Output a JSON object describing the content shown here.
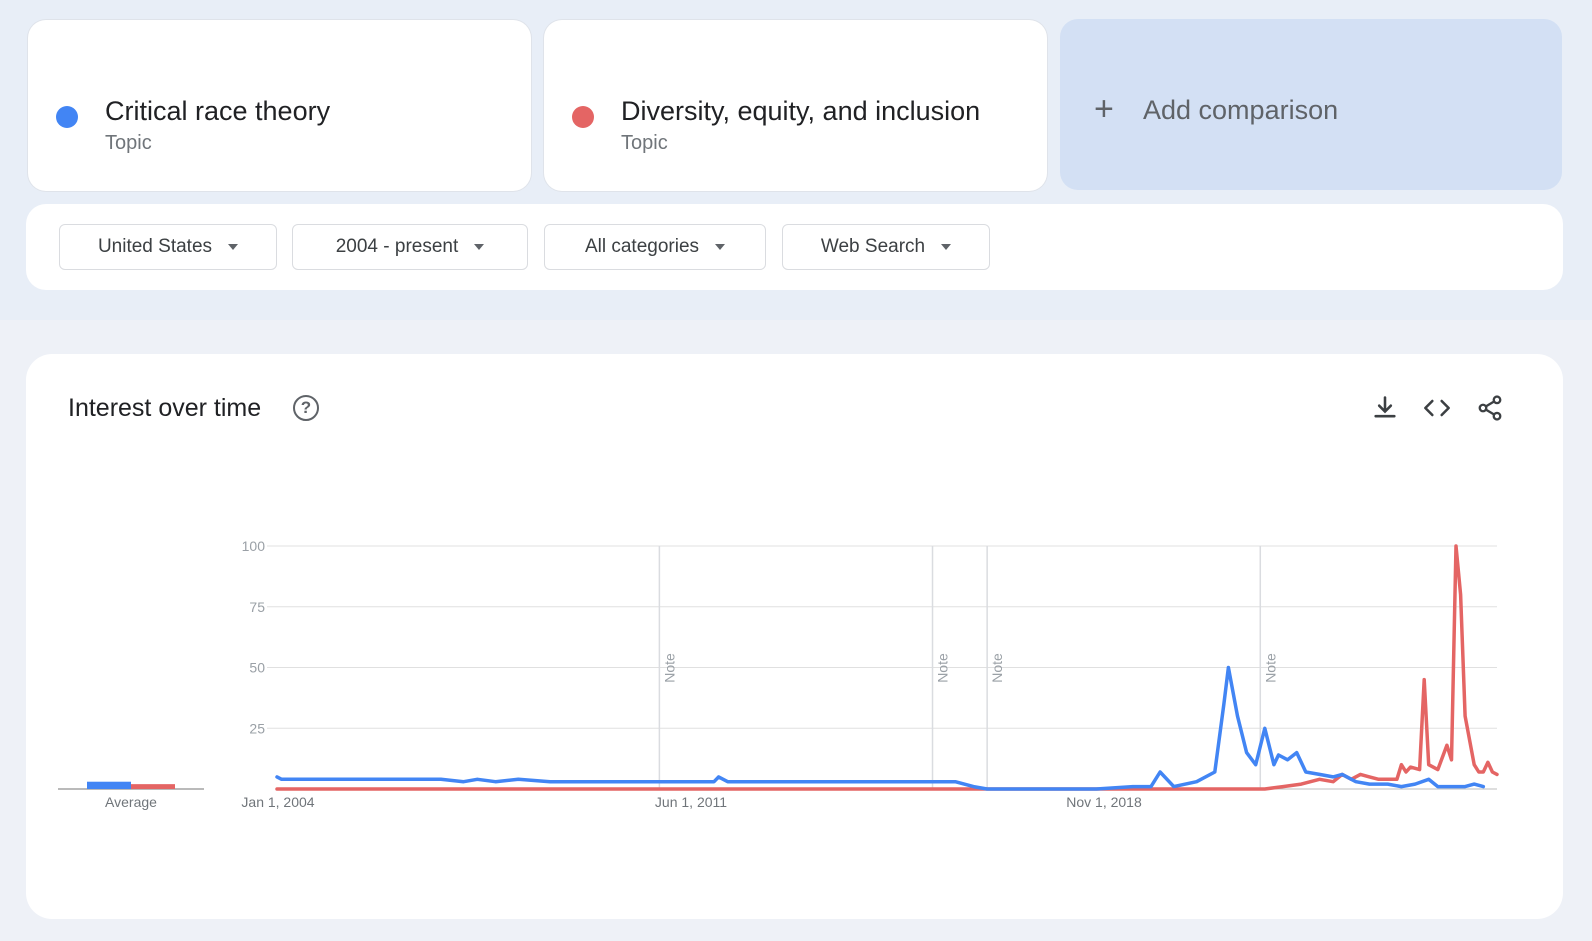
{
  "terms": [
    {
      "name": "Critical race theory",
      "type": "Topic",
      "color": "#4285f4"
    },
    {
      "name": "Diversity, equity, and inclusion",
      "type": "Topic",
      "color": "#e46564"
    }
  ],
  "add_comparison": {
    "label": "Add comparison",
    "icon": "plus-icon"
  },
  "filters": [
    {
      "label": "United States"
    },
    {
      "label": "2004 - present"
    },
    {
      "label": "All categories"
    },
    {
      "label": "Web Search"
    }
  ],
  "chart": {
    "title": "Interest over time",
    "help_icon": "?",
    "tools": [
      "download-icon",
      "embed-code-icon",
      "share-icon"
    ],
    "average_label": "Average",
    "note_label": "Note"
  },
  "chart_data": {
    "type": "line",
    "ylim": [
      0,
      100
    ],
    "y_ticks": [
      100,
      75,
      50,
      25
    ],
    "x_tick_labels": [
      "Jan 1, 2004",
      "Jun 1, 2011",
      "Nov 1, 2018"
    ],
    "grid": true,
    "notes": [
      "2011-01",
      "2016-01",
      "2017-01",
      "2022-01"
    ],
    "series": [
      {
        "name": "Critical race theory",
        "color": "#4285f4",
        "average": 3,
        "points": [
          [
            "2004-01",
            5
          ],
          [
            "2004-02",
            4
          ],
          [
            "2005-01",
            4
          ],
          [
            "2006-01",
            4
          ],
          [
            "2007-01",
            4
          ],
          [
            "2007-06",
            3
          ],
          [
            "2007-09",
            4
          ],
          [
            "2008-01",
            3
          ],
          [
            "2008-06",
            4
          ],
          [
            "2009-01",
            3
          ],
          [
            "2010-01",
            3
          ],
          [
            "2011-01",
            3
          ],
          [
            "2012-01",
            3
          ],
          [
            "2012-02",
            5
          ],
          [
            "2012-04",
            3
          ],
          [
            "2013-01",
            3
          ],
          [
            "2014-01",
            3
          ],
          [
            "2015-01",
            3
          ],
          [
            "2016-01",
            3
          ],
          [
            "2016-06",
            3
          ],
          [
            "2016-10",
            1
          ],
          [
            "2017-01",
            0
          ],
          [
            "2018-01",
            0
          ],
          [
            "2019-01",
            0
          ],
          [
            "2019-09",
            1
          ],
          [
            "2020-01",
            1
          ],
          [
            "2020-03",
            7
          ],
          [
            "2020-06",
            1
          ],
          [
            "2020-11",
            3
          ],
          [
            "2021-03",
            7
          ],
          [
            "2021-05",
            35
          ],
          [
            "2021-06",
            50
          ],
          [
            "2021-08",
            30
          ],
          [
            "2021-10",
            15
          ],
          [
            "2021-12",
            10
          ],
          [
            "2022-02",
            25
          ],
          [
            "2022-04",
            10
          ],
          [
            "2022-05",
            14
          ],
          [
            "2022-07",
            12
          ],
          [
            "2022-09",
            15
          ],
          [
            "2022-11",
            7
          ],
          [
            "2023-02",
            6
          ],
          [
            "2023-05",
            5
          ],
          [
            "2023-07",
            6
          ],
          [
            "2023-10",
            3
          ],
          [
            "2024-01",
            2
          ],
          [
            "2024-05",
            2
          ],
          [
            "2024-08",
            1
          ],
          [
            "2024-11",
            2
          ],
          [
            "2025-02",
            4
          ],
          [
            "2025-04",
            1
          ],
          [
            "2025-07",
            1
          ],
          [
            "2025-10",
            1
          ],
          [
            "2025-12",
            2
          ],
          [
            "2026-02",
            1
          ]
        ]
      },
      {
        "name": "Diversity, equity, and inclusion",
        "color": "#e46564",
        "average": 2,
        "points": [
          [
            "2004-01",
            0
          ],
          [
            "2010-01",
            0
          ],
          [
            "2015-01",
            0
          ],
          [
            "2020-01",
            0
          ],
          [
            "2022-02",
            0
          ],
          [
            "2022-06",
            1
          ],
          [
            "2022-10",
            2
          ],
          [
            "2023-02",
            4
          ],
          [
            "2023-05",
            3
          ],
          [
            "2023-07",
            6
          ],
          [
            "2023-09",
            4
          ],
          [
            "2023-11",
            6
          ],
          [
            "2024-01",
            5
          ],
          [
            "2024-03",
            4
          ],
          [
            "2024-05",
            4
          ],
          [
            "2024-07",
            4
          ],
          [
            "2024-08",
            10
          ],
          [
            "2024-09",
            7
          ],
          [
            "2024-10",
            9
          ],
          [
            "2024-12",
            8
          ],
          [
            "2025-01",
            45
          ],
          [
            "2025-02",
            10
          ],
          [
            "2025-04",
            8
          ],
          [
            "2025-06",
            18
          ],
          [
            "2025-07",
            12
          ],
          [
            "2025-08",
            100
          ],
          [
            "2025-09",
            80
          ],
          [
            "2025-10",
            30
          ],
          [
            "2025-12",
            10
          ],
          [
            "2026-01",
            7
          ],
          [
            "2026-02",
            7
          ],
          [
            "2026-03",
            11
          ],
          [
            "2026-04",
            7
          ],
          [
            "2026-05",
            6
          ]
        ]
      }
    ]
  }
}
